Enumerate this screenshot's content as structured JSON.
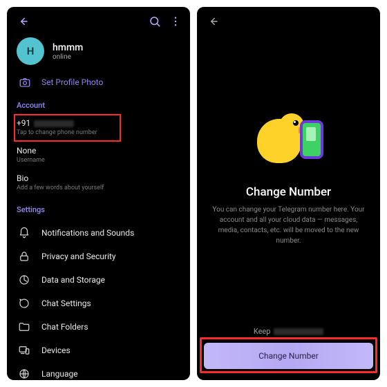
{
  "left": {
    "profile": {
      "avatar_initial": "H",
      "name": "hmmm",
      "status": "online"
    },
    "set_profile_photo": "Set Profile Photo",
    "account": {
      "header": "Account",
      "phone_prefix": "+91",
      "phone_sub": "Tap to change phone number",
      "username_value": "None",
      "username_sub": "Username",
      "bio_value": "Bio",
      "bio_sub": "Add a few words about yourself"
    },
    "settings": {
      "header": "Settings",
      "items": [
        {
          "icon": "bell-icon",
          "label": "Notifications and Sounds"
        },
        {
          "icon": "lock-icon",
          "label": "Privacy and Security"
        },
        {
          "icon": "disk-icon",
          "label": "Data and Storage"
        },
        {
          "icon": "chat-icon",
          "label": "Chat Settings"
        },
        {
          "icon": "folder-icon",
          "label": "Chat Folders"
        },
        {
          "icon": "devices-icon",
          "label": "Devices"
        },
        {
          "icon": "globe-icon",
          "label": "Language"
        }
      ]
    }
  },
  "right": {
    "title": "Change Number",
    "description": "You can change your Telegram number here. Your account and all your cloud data — messages, media, contacts, etc. will be moved to the new number.",
    "keep_label": "Keep",
    "button_label": "Change Number"
  }
}
